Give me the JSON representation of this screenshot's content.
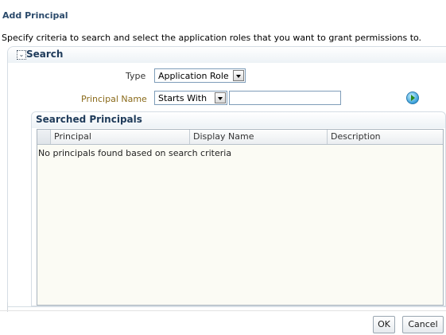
{
  "dialog": {
    "title": "Add Principal",
    "instructions": "Specify criteria to search and select the application roles that you want to grant permissions to."
  },
  "search": {
    "section_label": "Search",
    "type_label": "Type",
    "type_value": "Application Role",
    "principal_name_label": "Principal Name",
    "operator_value": "Starts With",
    "principal_name_value": ""
  },
  "results": {
    "title": "Searched Principals",
    "columns": [
      "Principal",
      "Display Name",
      "Description"
    ],
    "empty_message": "No principals found based on search criteria"
  },
  "footer": {
    "ok_label": "OK",
    "cancel_label": "Cancel"
  },
  "icons": {
    "disclose": "collapse-icon",
    "go": "go-arrow-icon"
  }
}
